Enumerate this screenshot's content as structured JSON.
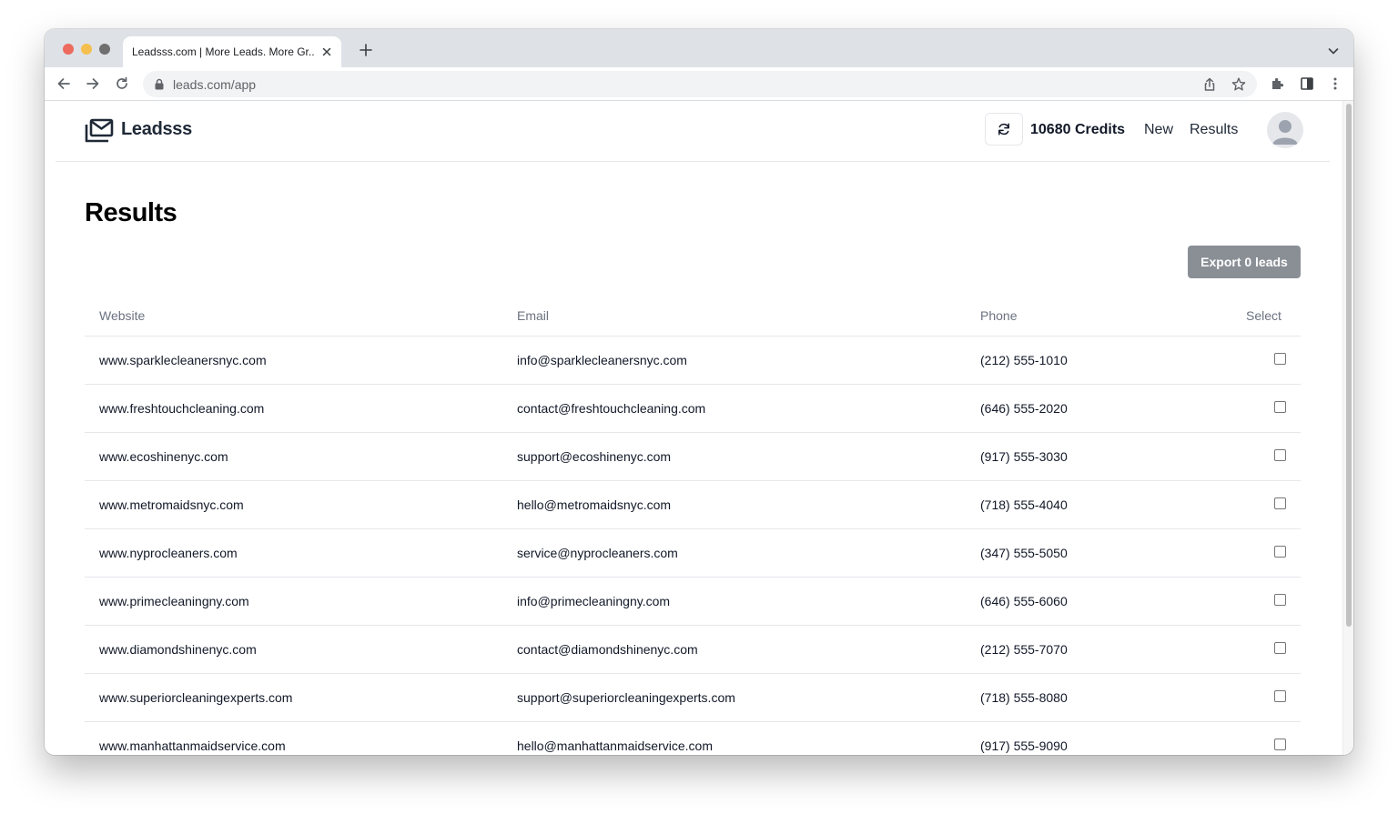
{
  "browser": {
    "tab_title": "Leadsss.com | More Leads. More Gr...",
    "url": "leads.com/app"
  },
  "header": {
    "brand": "Leadsss",
    "credits": "10680 Credits",
    "nav": [
      "New",
      "Results"
    ]
  },
  "main": {
    "title": "Results",
    "export_label": "Export 0 leads",
    "table": {
      "columns": [
        "Website",
        "Email",
        "Phone",
        "Select"
      ],
      "rows": [
        {
          "website": "www.sparklecleanersnyc.com",
          "email": "info@sparklecleanersnyc.com",
          "phone": "(212) 555-1010"
        },
        {
          "website": "www.freshtouchcleaning.com",
          "email": "contact@freshtouchcleaning.com",
          "phone": "(646) 555-2020"
        },
        {
          "website": "www.ecoshinenyc.com",
          "email": "support@ecoshinenyc.com",
          "phone": "(917) 555-3030"
        },
        {
          "website": "www.metromaidsnyc.com",
          "email": "hello@metromaidsnyc.com",
          "phone": "(718) 555-4040"
        },
        {
          "website": "www.nyprocleaners.com",
          "email": "service@nyprocleaners.com",
          "phone": "(347) 555-5050"
        },
        {
          "website": "www.primecleaningny.com",
          "email": "info@primecleaningny.com",
          "phone": "(646) 555-6060"
        },
        {
          "website": "www.diamondshinenyc.com",
          "email": "contact@diamondshinenyc.com",
          "phone": "(212) 555-7070"
        },
        {
          "website": "www.superiorcleaningexperts.com",
          "email": "support@superiorcleaningexperts.com",
          "phone": "(718) 555-8080"
        },
        {
          "website": "www.manhattanmaidservice.com",
          "email": "hello@manhattanmaidservice.com",
          "phone": "(917) 555-9090"
        }
      ]
    }
  }
}
